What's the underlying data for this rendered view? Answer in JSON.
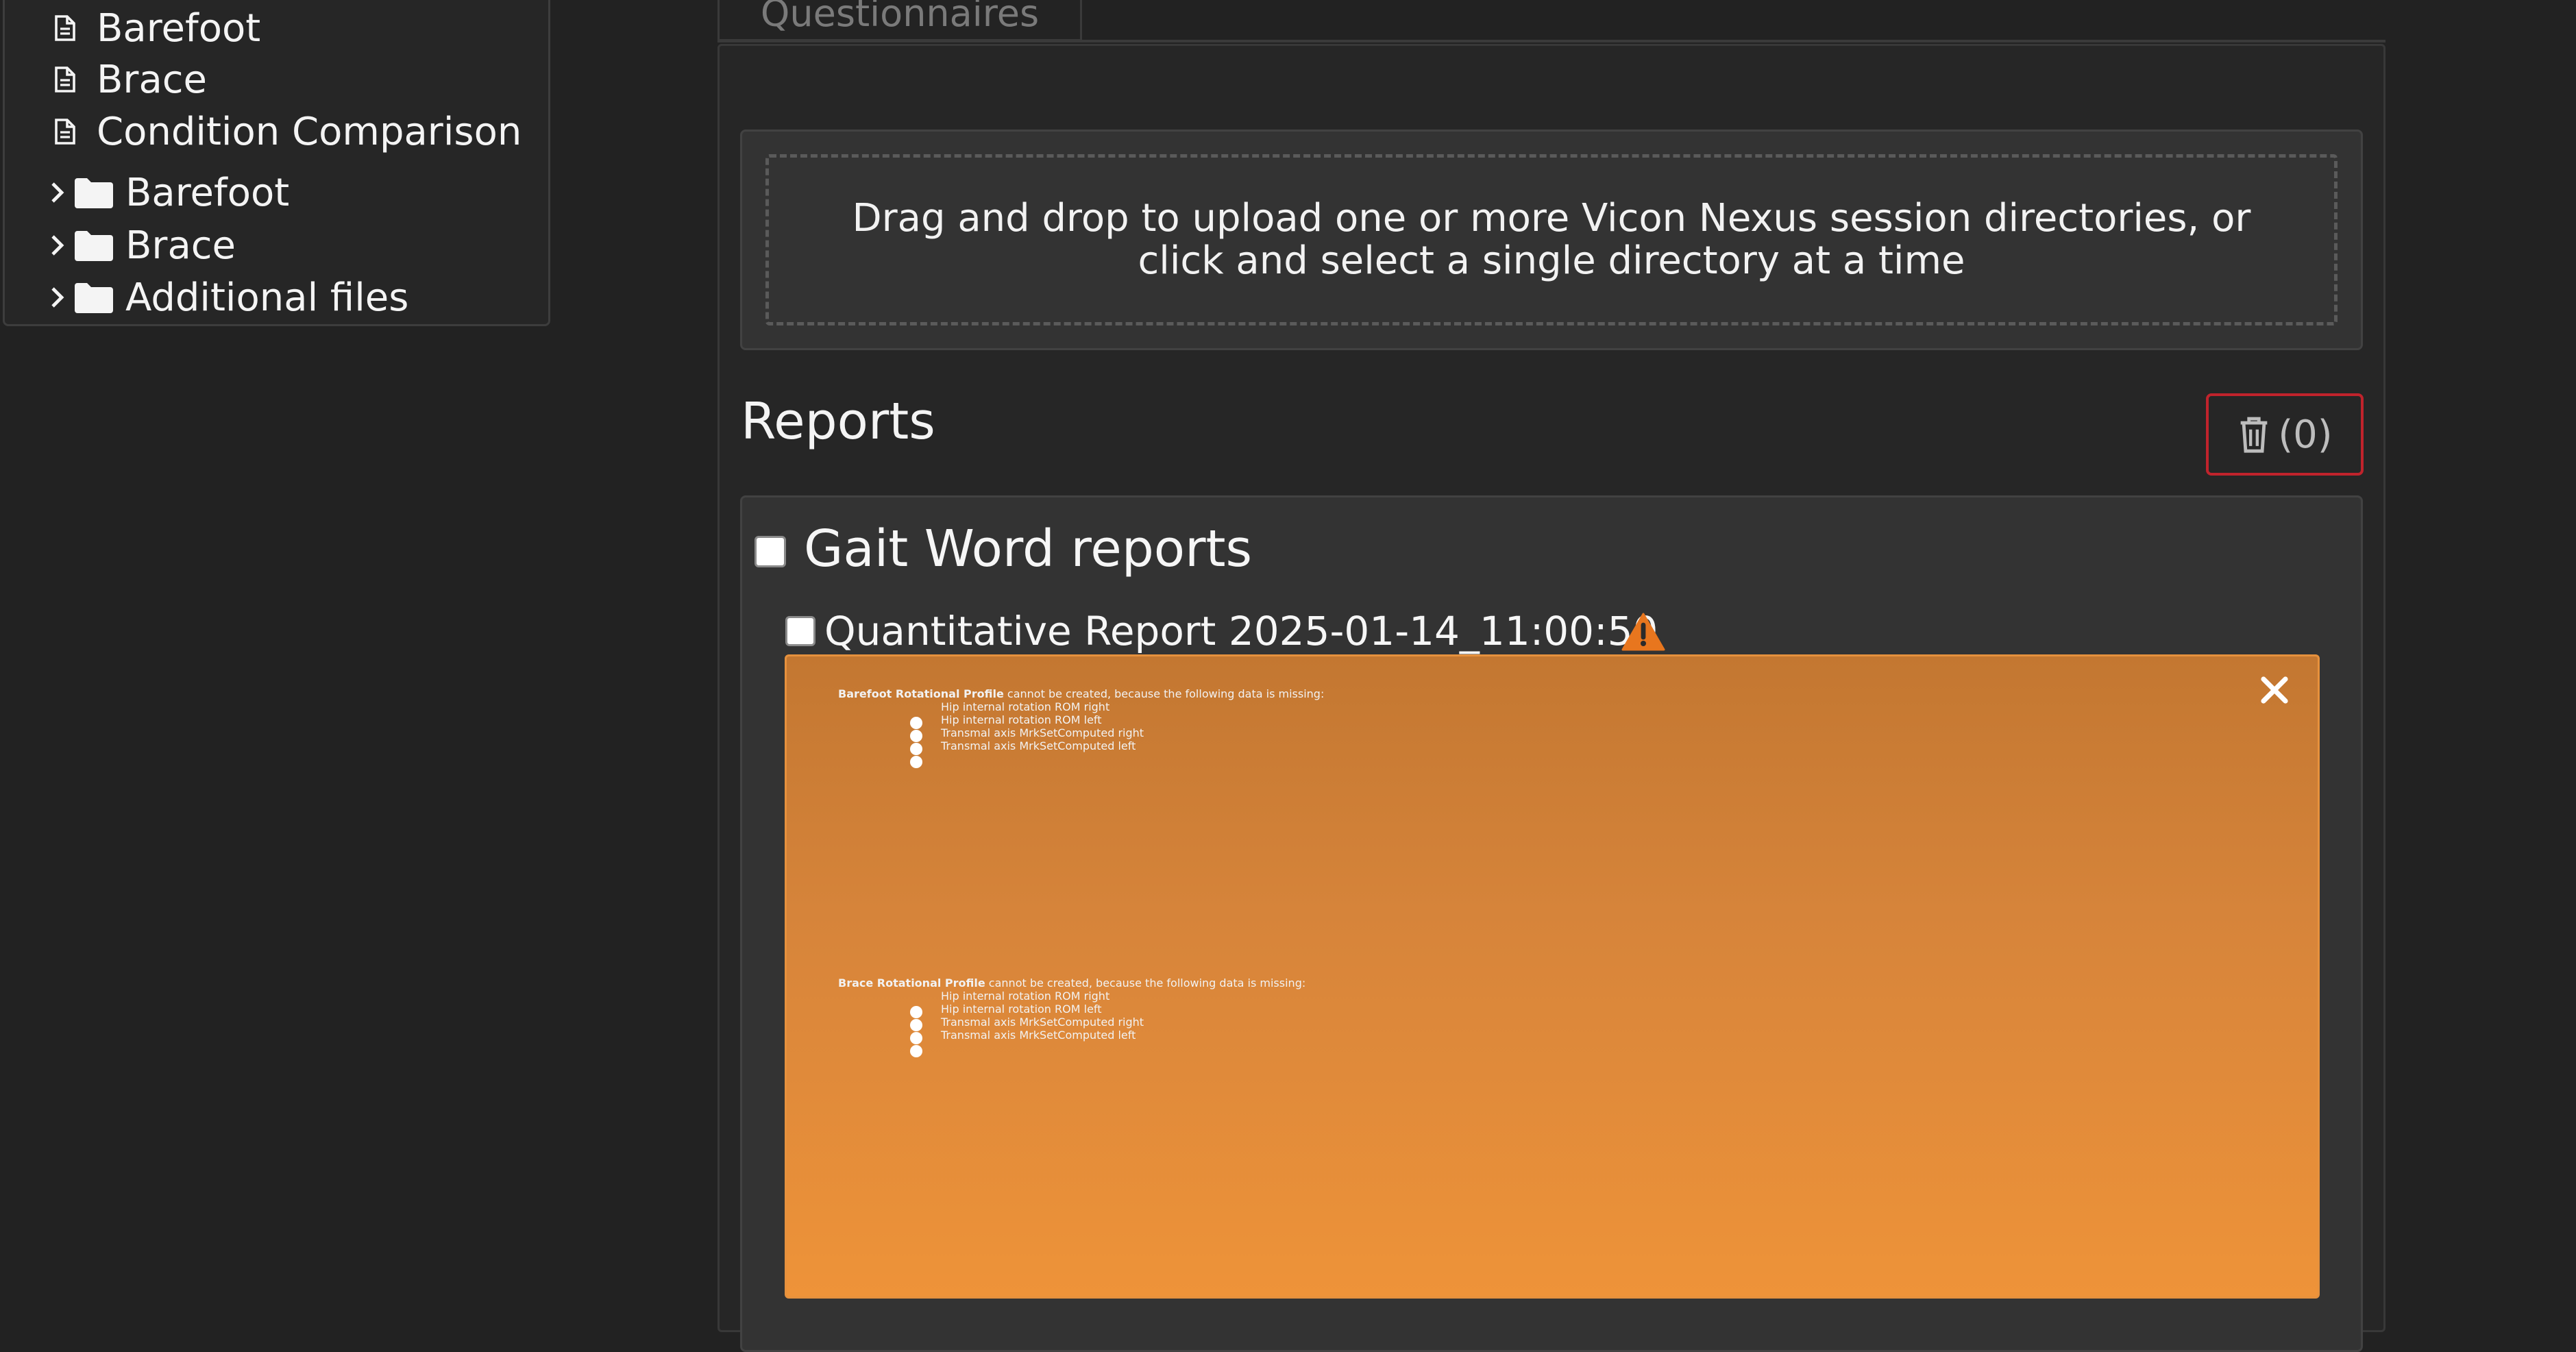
{
  "tree": {
    "files": [
      {
        "label": "Barefoot",
        "icon": "document-icon"
      },
      {
        "label": "Brace",
        "icon": "document-icon"
      },
      {
        "label": "Condition Comparison",
        "icon": "document-icon"
      }
    ],
    "folders": [
      {
        "label": "Barefoot",
        "icon": "folder-icon"
      },
      {
        "label": "Brace",
        "icon": "folder-icon"
      },
      {
        "label": "Additional files",
        "icon": "folder-icon"
      }
    ]
  },
  "tabs": {
    "questionnaires_label": "Questionnaires"
  },
  "upload": {
    "text": "Drag and drop to upload one or more Vicon Nexus session directories, or click and select a single directory at a time"
  },
  "reports": {
    "title": "Reports",
    "delete_label": "(0)",
    "delete_icon": "trash-icon",
    "group_title": "Gait Word reports",
    "report_title": "Quantitative Report 2025-01-14_11:00:50",
    "warning_icon": "warning-triangle-icon"
  },
  "alert": {
    "close_label": "×",
    "blocks": [
      {
        "name": "Barefoot Rotational Profile",
        "message": " cannot be created, because the following data is missing:",
        "items": [
          "Hip internal rotation ROM right",
          "Hip internal rotation ROM left",
          "Transmal axis MrkSetComputed right",
          "Transmal axis MrkSetComputed left"
        ]
      },
      {
        "name": "Brace Rotational Profile",
        "message": " cannot be created, because the following data is missing:",
        "items": [
          "Hip internal rotation ROM right",
          "Hip internal rotation ROM left",
          "Transmal axis MrkSetComputed right",
          "Transmal axis MrkSetComputed left"
        ]
      }
    ]
  },
  "colors": {
    "background": "#222222",
    "panel": "#333333",
    "alert_orange": "#ee9339",
    "warning_icon": "#e8761e",
    "danger_border": "#c0232c"
  }
}
